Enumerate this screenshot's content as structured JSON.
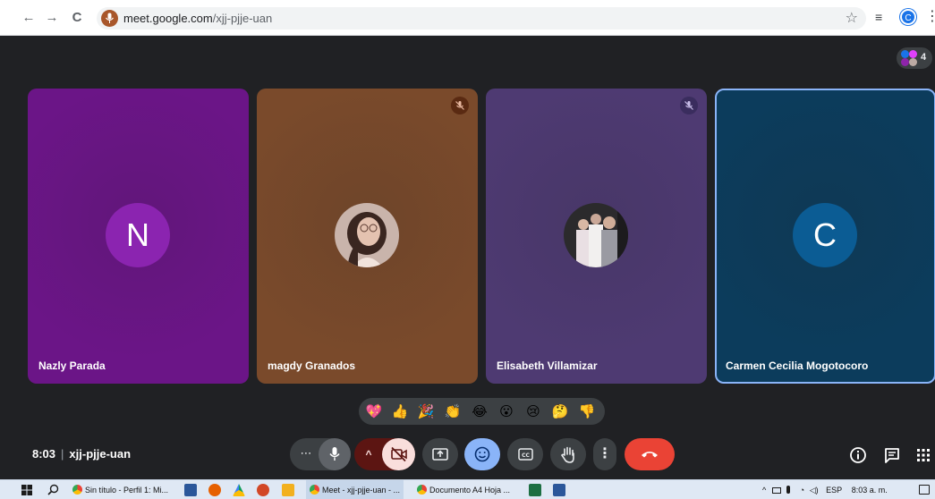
{
  "browser": {
    "url_host": "meet.google.com",
    "url_path": "/xjj-pjje-uan",
    "profile_initial": "C"
  },
  "meeting": {
    "time": "8:03",
    "code": "xjj-pjje-uan",
    "participant_count": "4"
  },
  "participants": [
    {
      "name": "Nazly Parada",
      "initial": "N",
      "tile_color": "#6b1587",
      "avatar_color": "#8b24b0",
      "muted": false
    },
    {
      "name": "magdy Granados",
      "initial": "",
      "tile_color": "#7a4a2b",
      "muted": true
    },
    {
      "name": "Elisabeth Villamizar",
      "initial": "",
      "tile_color": "#4e3a72",
      "muted": true
    },
    {
      "name": "Carmen Cecilia Mogotocoro",
      "initial": "C",
      "tile_color": "#0c3c5c",
      "avatar_color": "#0b5c94",
      "muted": false,
      "speaking": true
    }
  ],
  "reactions": [
    "💖",
    "👍",
    "🎉",
    "👏",
    "😂",
    "😮",
    "😢",
    "🤔",
    "👎"
  ],
  "taskbar": {
    "apps": [
      {
        "label": "Sin título - Perfil 1: Mi...",
        "icon": "chrome-icon"
      },
      {
        "label": "Meet - xjj-pjje-uan - ...",
        "icon": "chrome-icon"
      },
      {
        "label": "Documento A4 Hoja ...",
        "icon": "chrome-icon"
      }
    ],
    "language": "ESP",
    "clock": "8:03 a. m."
  },
  "colors": {
    "background": "#202124",
    "control_bg": "#3c4043",
    "end_call": "#ea4335",
    "reactions_active": "#8ab4f8",
    "camera_off": "#f9dedc"
  }
}
